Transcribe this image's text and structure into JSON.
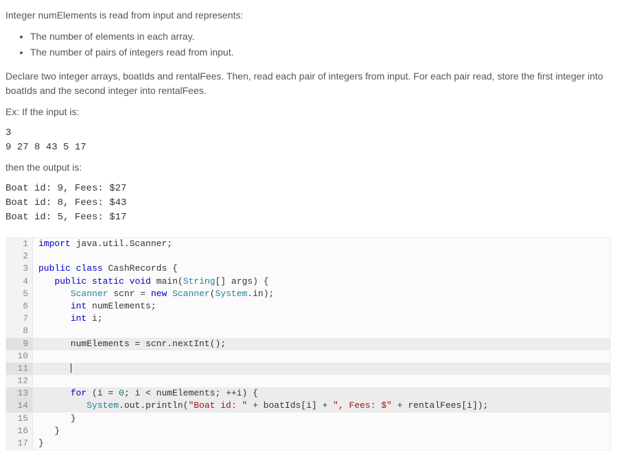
{
  "problem": {
    "intro": "Integer numElements is read from input and represents:",
    "bullets": [
      "The number of elements in each array.",
      "The number of pairs of integers read from input."
    ],
    "declare": "Declare two integer arrays, boatIds and rentalFees. Then, read each pair of integers from input. For each pair read, store the first integer into boatIds and the second integer into rentalFees.",
    "ex_label": "Ex: If the input is:",
    "input_sample": "3\n9 27 8 43 5 17",
    "then_label": "then the output is:",
    "output_sample": "Boat id: 9, Fees: $27\nBoat id: 8, Fees: $43\nBoat id: 5, Fees: $17"
  },
  "code": {
    "highlight_rows": [
      9,
      11,
      13,
      14
    ],
    "lines": [
      {
        "n": 1,
        "tokens": [
          [
            "kw",
            "import"
          ],
          [
            "",
            " java.util.Scanner;"
          ]
        ]
      },
      {
        "n": 2,
        "tokens": []
      },
      {
        "n": 3,
        "tokens": [
          [
            "kw",
            "public"
          ],
          [
            "",
            " "
          ],
          [
            "kw",
            "class"
          ],
          [
            "",
            " CashRecords {"
          ]
        ]
      },
      {
        "n": 4,
        "tokens": [
          [
            "",
            "   "
          ],
          [
            "kw",
            "public"
          ],
          [
            "",
            " "
          ],
          [
            "kw",
            "static"
          ],
          [
            "",
            " "
          ],
          [
            "kw",
            "void"
          ],
          [
            "",
            " main("
          ],
          [
            "type",
            "String"
          ],
          [
            "",
            "[] args) {"
          ]
        ]
      },
      {
        "n": 5,
        "tokens": [
          [
            "",
            "      "
          ],
          [
            "type",
            "Scanner"
          ],
          [
            "",
            " scnr = "
          ],
          [
            "kw",
            "new"
          ],
          [
            "",
            " "
          ],
          [
            "type",
            "Scanner"
          ],
          [
            "",
            "("
          ],
          [
            "type",
            "System"
          ],
          [
            "",
            ".in);"
          ]
        ]
      },
      {
        "n": 6,
        "tokens": [
          [
            "",
            "      "
          ],
          [
            "kw",
            "int"
          ],
          [
            "",
            " numElements;"
          ]
        ]
      },
      {
        "n": 7,
        "tokens": [
          [
            "",
            "      "
          ],
          [
            "kw",
            "int"
          ],
          [
            "",
            " i;"
          ]
        ]
      },
      {
        "n": 8,
        "tokens": []
      },
      {
        "n": 9,
        "tokens": [
          [
            "",
            "      numElements = scnr.nextInt();"
          ]
        ]
      },
      {
        "n": 10,
        "tokens": []
      },
      {
        "n": 11,
        "tokens": [
          [
            "",
            "      "
          ],
          [
            "cursor",
            ""
          ]
        ]
      },
      {
        "n": 12,
        "tokens": []
      },
      {
        "n": 13,
        "tokens": [
          [
            "",
            "      "
          ],
          [
            "kw",
            "for"
          ],
          [
            "",
            " (i = "
          ],
          [
            "num",
            "0"
          ],
          [
            "",
            "; i < numElements; ++i) {"
          ]
        ]
      },
      {
        "n": 14,
        "tokens": [
          [
            "",
            "         "
          ],
          [
            "type",
            "System"
          ],
          [
            "",
            ".out.println("
          ],
          [
            "str",
            "\"Boat id: \""
          ],
          [
            "",
            " + boatIds[i] + "
          ],
          [
            "str",
            "\", Fees: $\""
          ],
          [
            "",
            " + rentalFees[i]);"
          ]
        ]
      },
      {
        "n": 15,
        "tokens": [
          [
            "",
            "      }"
          ]
        ]
      },
      {
        "n": 16,
        "tokens": [
          [
            "",
            "   }"
          ]
        ]
      },
      {
        "n": 17,
        "tokens": [
          [
            "",
            "}"
          ]
        ]
      }
    ]
  }
}
